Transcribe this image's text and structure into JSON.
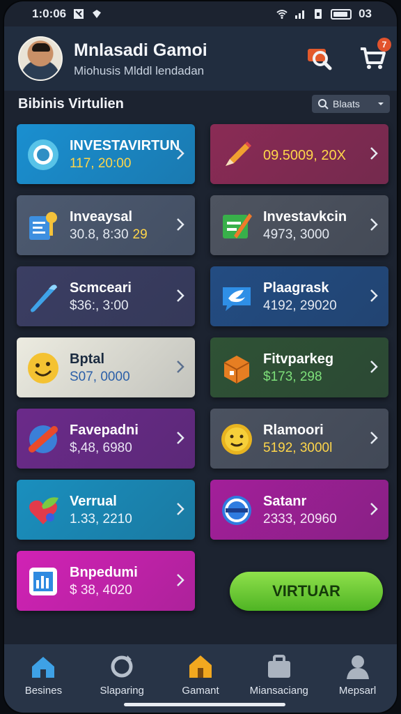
{
  "status": {
    "time": "1:0:06",
    "battery_text": "03"
  },
  "header": {
    "name": "Mnlasadi Gamoi",
    "subtitle": "Miohusis Mlddl lendadan",
    "icons": [
      "search-icon",
      "cart-icon"
    ],
    "cart_badge": "7"
  },
  "section": {
    "title": "Bibinis Virtulien",
    "filter_label": "Blaats"
  },
  "cards": [
    {
      "title": "INVESTAVIRTUN",
      "value": "117, 20:00",
      "icon": "coin-icon",
      "bg": "#1a8fd0",
      "title_color": "#ffffff",
      "value_color": "#ffd64a"
    },
    {
      "title": "",
      "value": "09.5009, 20X",
      "icon": "pencil-icon",
      "bg": "#8a2b55",
      "title_color": "#ffffff",
      "value_color": "#ffd64a"
    },
    {
      "title": "Inveaysal",
      "value": "30.8, 8:30",
      "value_extra": "29",
      "icon": "key-card-icon",
      "bg": "#4d5a70",
      "title_color": "#ffffff",
      "value_color": "#e4e9f1"
    },
    {
      "title": "Investavkcin",
      "value": "4973, 3000",
      "icon": "green-pencil-icon",
      "bg": "#4e5460",
      "title_color": "#ffffff",
      "value_color": "#e4e9f1"
    },
    {
      "title": "Scmceari",
      "value": "$36:, 3:00",
      "icon": "brush-icon",
      "bg": "#3b3e63",
      "title_color": "#ffffff",
      "value_color": "#e4e9f1"
    },
    {
      "title": "Plaagrask",
      "value": "4192, 29020",
      "icon": "bird-icon",
      "bg": "#234c82",
      "title_color": "#ffffff",
      "value_color": "#e4e9f1"
    },
    {
      "title": "Bptal",
      "value": "S07, 0000",
      "icon": "smile-icon",
      "bg": "#ecebe0",
      "title_color": "#1b2b40",
      "value_color": "#2b5fa8"
    },
    {
      "title": "Fitvparkeg",
      "value": "$173, 298",
      "icon": "box-icon",
      "bg": "#2f5235",
      "title_color": "#ffffff",
      "value_color": "#7ee07a"
    },
    {
      "title": "Favepadni",
      "value": "$,48, 6980",
      "icon": "ban-icon",
      "bg": "#6b2a8a",
      "title_color": "#ffffff",
      "value_color": "#e8e3f3"
    },
    {
      "title": "Rlamoori",
      "value": "5192, 3000l",
      "icon": "emoji-coin-icon",
      "bg": "#4b5260",
      "title_color": "#ffffff",
      "value_color": "#ffd64a"
    },
    {
      "title": "Verrual",
      "value": "1.33, 2210",
      "icon": "heart-leaf-icon",
      "bg": "#1a8fbe",
      "title_color": "#ffffff",
      "value_color": "#eaf4fb"
    },
    {
      "title": "Satanr",
      "value": "2333, 20960",
      "icon": "wheel-icon",
      "bg": "#a31f9a",
      "title_color": "#ffffff",
      "value_color": "#f4e6f6"
    },
    {
      "title": "Bnpedumi",
      "value": "$ 38, 4020",
      "icon": "chart-box-icon",
      "bg": "#d122b5",
      "title_color": "#ffffff",
      "value_color": "#fde8fa"
    }
  ],
  "cta": {
    "label": "VIRTUAR"
  },
  "nav": [
    {
      "label": "Besines",
      "icon": "home-icon",
      "color": "#3ea1e6"
    },
    {
      "label": "Slaparing",
      "icon": "refresh-icon",
      "color": "#b7c0cc"
    },
    {
      "label": "Gamant",
      "icon": "house-orange-icon",
      "color": "#f2a81f"
    },
    {
      "label": "Miansaciang",
      "icon": "briefcase-icon",
      "color": "#aab3bf"
    },
    {
      "label": "Mepsarl",
      "icon": "user-icon",
      "color": "#aab3bf"
    }
  ]
}
